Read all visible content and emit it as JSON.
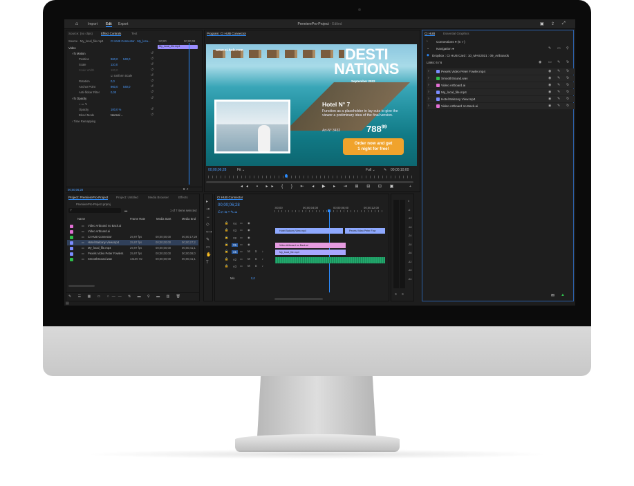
{
  "topbar": {
    "home_icon": "home-icon",
    "nav": [
      "Import",
      "Edit",
      "Export"
    ],
    "active_nav": "Edit",
    "title": "PremierePro-Project",
    "title_suffix": " - Edited"
  },
  "effect_controls": {
    "tabs": [
      "Source: (no clips)",
      "Effect Controls",
      "Text"
    ],
    "source_line": "Source · My_local_file.mp4",
    "source_target": "CI HUB Connector · My_loca...",
    "timecode_start": ":00;00",
    "timecode_end": "00;00;08",
    "clip_label": "My_local_file.mp4",
    "section_video": "Video",
    "motion": "Motion",
    "rows": [
      {
        "label": "Position",
        "v1": "960,0",
        "v2": "540,0"
      },
      {
        "label": "Scale",
        "v1": "110,0",
        "v2": ""
      },
      {
        "label": "Scale Width",
        "v1": "100,0",
        "v2": ""
      },
      {
        "label": "Uniform Scale",
        "v1": "",
        "v2": ""
      },
      {
        "label": "Rotation",
        "v1": "0,0",
        "v2": ""
      },
      {
        "label": "Anchor Point",
        "v1": "960,0",
        "v2": "540,0"
      },
      {
        "label": "Anti-flicker Filter",
        "v1": "0,00",
        "v2": ""
      }
    ],
    "opacity": "Opacity",
    "opacity_value": "100,0 %",
    "blend_mode_label": "Blend Mode",
    "blend_mode_value": "Normal",
    "time_remapping": "Time Remapping",
    "footer_timecode": "00;00;06;28"
  },
  "program": {
    "tab": "Program: CI HUB Connector",
    "url": "www.ci-hub.com",
    "headline1": "DESTI",
    "headline2": "NATIONS",
    "date": "September 2022",
    "hotel": "Hotel N° 7",
    "body": "Function as a placeholder in lay outs to give the viewer a preliminary idea of the final version.",
    "article": "Art-N° 3432",
    "price_main": "788",
    "price_cents": "99",
    "cta_line1": "Order now and get",
    "cta_line2": "1 night for free!",
    "timecode": "00;00;06;28",
    "fit": "Fit",
    "quality": "Full",
    "duration": "00;00;10;00"
  },
  "project": {
    "tabs": [
      "Project: PremierePro-Project",
      "Project: Untitled",
      "Media Browser",
      "Effects"
    ],
    "path": "PremierePro-Project.prproj",
    "selected_count": "1 of 7 items selected",
    "columns": [
      "Name",
      "Frame Rate",
      "Media Start",
      "Media End"
    ],
    "items": [
      {
        "name": "Video Artboard no Back.ai",
        "rate": "",
        "start": "",
        "end": "",
        "color": "#e26fd4"
      },
      {
        "name": "Video Artboard.ai",
        "rate": "",
        "start": "",
        "end": "",
        "color": "#e26fd4"
      },
      {
        "name": "CI HUB Connector",
        "rate": "29,97 fps",
        "start": "00;00;00;00",
        "end": "00;00;17;29",
        "color": "#2fbf4b"
      },
      {
        "name": "Hotel Balcony View.mp4",
        "rate": "29,97 fps",
        "start": "00;00;00;00",
        "end": "00;00;27;2",
        "color": "#7b8cff"
      },
      {
        "name": "My_local_file.mp4",
        "rate": "29,97 fps",
        "start": "00;00;00;00",
        "end": "00;00;41;1",
        "color": "#7b8cff"
      },
      {
        "name": "Pexels Video Peter Fowlers",
        "rate": "29,97 fps",
        "start": "00;00;00;00",
        "end": "00;00;08;0",
        "color": "#7b8cff"
      },
      {
        "name": "SmoothSound.wav",
        "rate": "44100 Hz",
        "start": "00;00;00;00",
        "end": "00;00;41;1",
        "color": "#2fbf4b"
      }
    ]
  },
  "timeline": {
    "tab": "CI HUB Connector",
    "timecode": "00;00;06;28",
    "ruler": [
      ":00;00",
      "00;00;04;00",
      "00;00;08;00",
      "00;00;12;00"
    ],
    "video_tracks": [
      "V4",
      "V3",
      "V2",
      "V1"
    ],
    "audio_tracks": [
      "A1",
      "A2",
      "A3"
    ],
    "mix": "Mix",
    "mix_value": "0,0",
    "clips": [
      {
        "label": "Hotel Balcony View.mp4",
        "color": "#8ea9ff"
      },
      {
        "label": "Pexels Video Peter Fow",
        "color": "#8ea9ff"
      },
      {
        "label": "Video Artboard no Back.ai",
        "color": "#e59be0"
      },
      {
        "label": "My_local_file.mp4",
        "color": "#a9a7ff"
      }
    ]
  },
  "meter": {
    "scale": [
      "0",
      "-6",
      "-12",
      "-18",
      "-24",
      "-30",
      "-36",
      "-42",
      "-48",
      "-54"
    ],
    "solo": [
      "S",
      "S"
    ]
  },
  "cihub": {
    "tabs": [
      "CI HUB",
      "Essential Graphics"
    ],
    "connections": "Connections",
    "connections_count": "6",
    "navigation": "Navigation",
    "breadcrumb": "Dropbox : CI HUB Card : 10_MAX2021 : 09_Artboards",
    "links": "Links: 6 / 6",
    "files": [
      {
        "name": "Pexels Video Peter Fowler.mp4",
        "color": "#7b8cff"
      },
      {
        "name": "SmoothSound.wav",
        "color": "#2fbf4b"
      },
      {
        "name": "Video Artboard.ai",
        "color": "#e26fd4"
      },
      {
        "name": "My_local_file.mp4",
        "color": "#7b8cff"
      },
      {
        "name": "Hotel Balcony View.mp4",
        "color": "#7b8cff"
      },
      {
        "name": "Video Artboard no Back.ai",
        "color": "#e26fd4"
      }
    ]
  }
}
